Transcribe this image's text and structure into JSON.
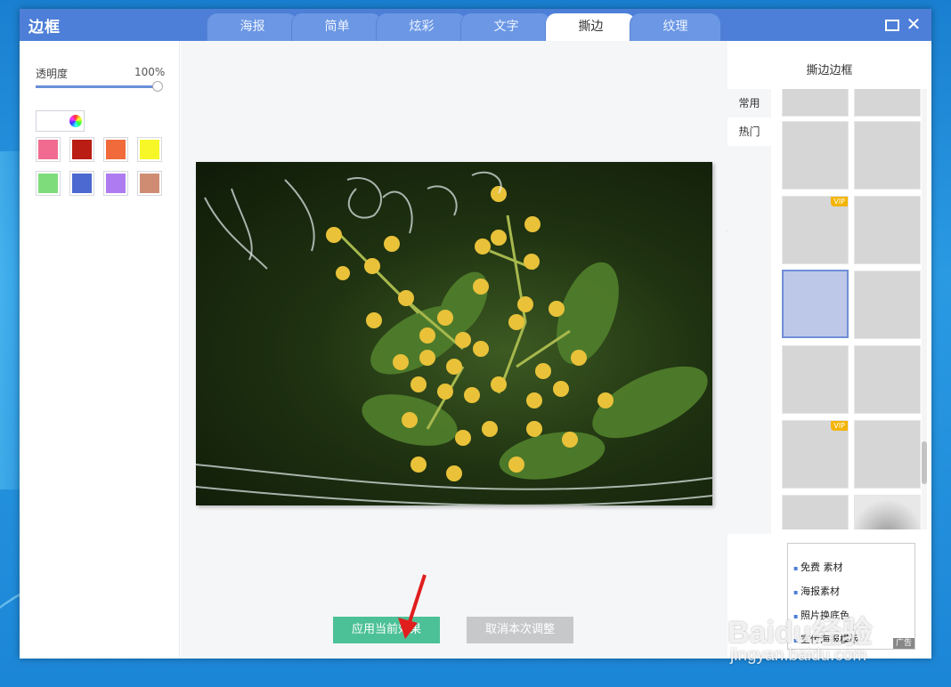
{
  "window": {
    "title": "边框",
    "tabs": [
      {
        "label": "海报",
        "active": false
      },
      {
        "label": "简单",
        "active": false
      },
      {
        "label": "炫彩",
        "active": false
      },
      {
        "label": "文字",
        "active": false
      },
      {
        "label": "撕边",
        "active": true
      },
      {
        "label": "纹理",
        "active": false
      }
    ],
    "maximize_icon": "maximize-icon",
    "close_icon": "close-icon",
    "close_glyph": "✕"
  },
  "left_panel": {
    "opacity_label": "透明度",
    "opacity_value": "100%",
    "opacity_fraction": 1.0,
    "color_wheel_icon": "color-wheel-icon",
    "swatches": [
      "#f06b8f",
      "#b91d13",
      "#f06a3b",
      "#f7f728",
      "#7fdc7b",
      "#4b69d0",
      "#ae7cf0",
      "#cf8c73"
    ]
  },
  "center": {
    "apply_button": "应用当前效果",
    "cancel_button": "取消本次调整",
    "accent_color": "#4cc197"
  },
  "right_panel": {
    "title": "撕边边框",
    "categories": [
      {
        "label": "常用",
        "active": false
      },
      {
        "label": "热门",
        "active": true
      }
    ],
    "thumbnails": [
      {
        "vip": false,
        "selected": false
      },
      {
        "vip": false,
        "selected": false
      },
      {
        "vip": false,
        "selected": false
      },
      {
        "vip": false,
        "selected": false
      },
      {
        "vip": true,
        "selected": false
      },
      {
        "vip": false,
        "selected": false
      },
      {
        "vip": false,
        "selected": true
      },
      {
        "vip": false,
        "selected": false
      },
      {
        "vip": false,
        "selected": false
      },
      {
        "vip": false,
        "selected": false
      },
      {
        "vip": true,
        "selected": false
      },
      {
        "vip": false,
        "selected": false
      },
      {
        "vip": false,
        "selected": false
      },
      {
        "vip": false,
        "selected": false
      }
    ],
    "vip_label": "VIP",
    "ad": {
      "items": [
        "免费 素材",
        "海报素材",
        "照片换底色",
        "宣传海报模板"
      ],
      "tag": "广告"
    }
  },
  "watermark": {
    "text": "Baidu经验",
    "url": "jingyan.baidu.com"
  }
}
